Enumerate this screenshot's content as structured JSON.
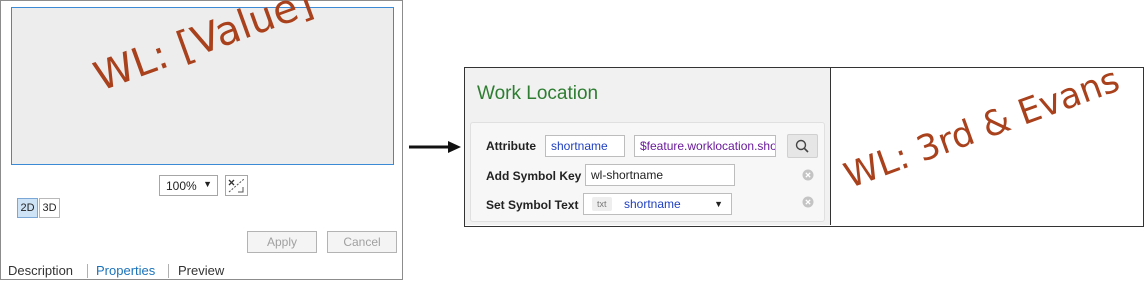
{
  "left_panel": {
    "preview_text": "WL: [Value]",
    "zoom": {
      "value": "100%"
    },
    "view_modes": [
      "2D",
      "3D"
    ],
    "buttons": {
      "apply": "Apply",
      "cancel": "Cancel"
    },
    "tabs": [
      "Description",
      "Properties",
      "Preview"
    ],
    "active_tab": "Properties"
  },
  "right_panel": {
    "title": "Work Location",
    "rows": {
      "attribute": {
        "label": "Attribute",
        "name": "shortname",
        "expression": "$feature.worklocation.shortname"
      },
      "symbol_key": {
        "label": "Add Symbol Key",
        "value": "wl-shortname"
      },
      "symbol_text": {
        "label": "Set Symbol Text",
        "type_badge": "txt",
        "value": "shortname"
      }
    },
    "result_text": "WL: 3rd & Evans"
  },
  "colors": {
    "label_text": "#a8411c",
    "title_green": "#2e7d32",
    "accent_blue": "#1a72bb",
    "expression_purple": "#6a1b9a"
  },
  "icons": [
    "chevron-down-icon",
    "fit-extent-icon",
    "arrow-right-icon",
    "search-icon",
    "clear-icon"
  ]
}
